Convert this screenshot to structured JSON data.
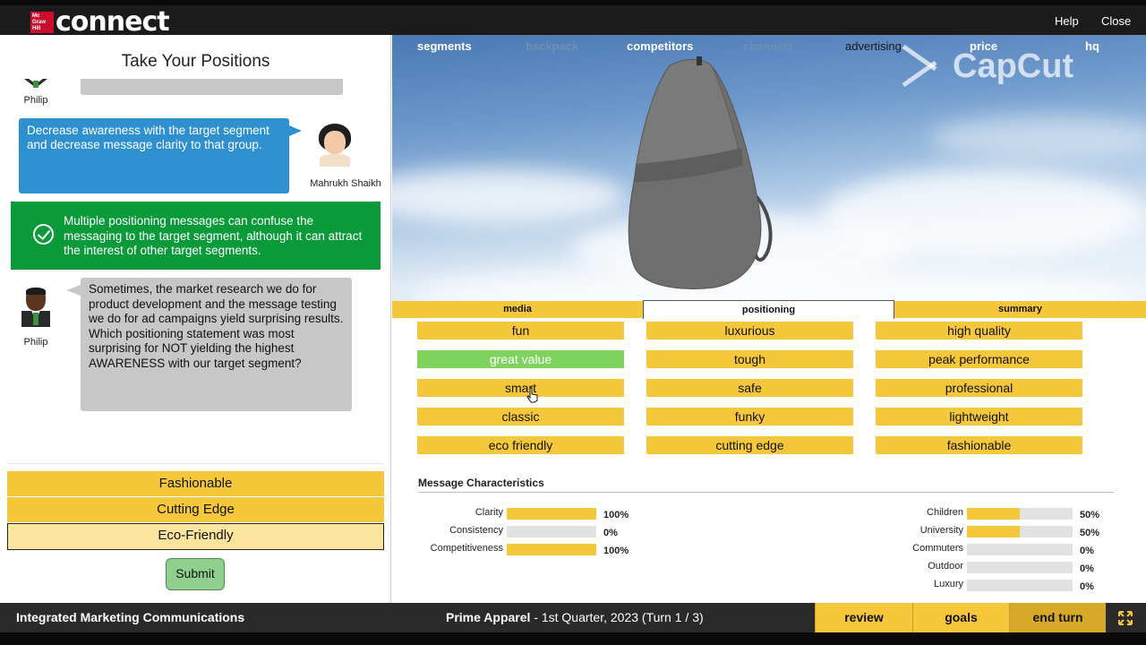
{
  "app": {
    "brand_badge": "Mc Graw Hill",
    "brand_name": "connect",
    "help_label": "Help",
    "close_label": "Close"
  },
  "left": {
    "title": "Take Your Positions",
    "top_speaker": "Philip",
    "blue_bubble": "Decrease awareness with the target segment and decrease message clarity to that group.",
    "blue_speaker": "Mahrukh Shaikh",
    "feedback": "Multiple positioning messages can confuse the messaging to the target segment, although it can attract the interest of other target segments.",
    "question": "Sometimes, the market research we do for product development and the message testing we do for ad campaigns yield surprising results. Which positioning statement was most surprising for NOT yielding the highest AWARENESS with our target segment?",
    "question_speaker": "Philip",
    "answers": [
      "Fashionable",
      "Cutting Edge",
      "Eco-Friendly"
    ],
    "submit_label": "Submit"
  },
  "nav": {
    "tabs": [
      "segments",
      "backpack",
      "competitors",
      "channels",
      "advertising",
      "price",
      "hq"
    ]
  },
  "watermark": "CapCut",
  "subtabs": [
    "media",
    "positioning",
    "summary"
  ],
  "positioning": {
    "col1": [
      "fun",
      "great value",
      "smart",
      "classic",
      "eco friendly"
    ],
    "col2": [
      "luxurious",
      "tough",
      "safe",
      "funky",
      "cutting edge"
    ],
    "col3": [
      "high quality",
      "peak performance",
      "professional",
      "lightweight",
      "fashionable"
    ],
    "selected": "great value"
  },
  "message": {
    "title": "Message Characteristics",
    "metrics": [
      {
        "label": "Clarity",
        "value": 100,
        "pct": "100%"
      },
      {
        "label": "Consistency",
        "value": 0,
        "pct": "0%"
      },
      {
        "label": "Competitiveness",
        "value": 100,
        "pct": "100%"
      }
    ],
    "segments": [
      {
        "label": "Children",
        "value": 50,
        "pct": "50%"
      },
      {
        "label": "University",
        "value": 50,
        "pct": "50%"
      },
      {
        "label": "Commuters",
        "value": 0,
        "pct": "0%"
      },
      {
        "label": "Outdoor",
        "value": 0,
        "pct": "0%"
      },
      {
        "label": "Luxury",
        "value": 0,
        "pct": "0%"
      }
    ]
  },
  "footer": {
    "left": "Integrated Marketing Communications",
    "company": "Prime Apparel",
    "period": " - 1st Quarter, 2023 (Turn 1 / 3)",
    "review": "review",
    "goals": "goals",
    "end_turn": "end turn"
  },
  "colors": {
    "accent_yellow": "#f5c73a",
    "success_green": "#0a9a3a",
    "bubble_blue": "#2f90cf",
    "selected_green": "#7ed35f"
  }
}
